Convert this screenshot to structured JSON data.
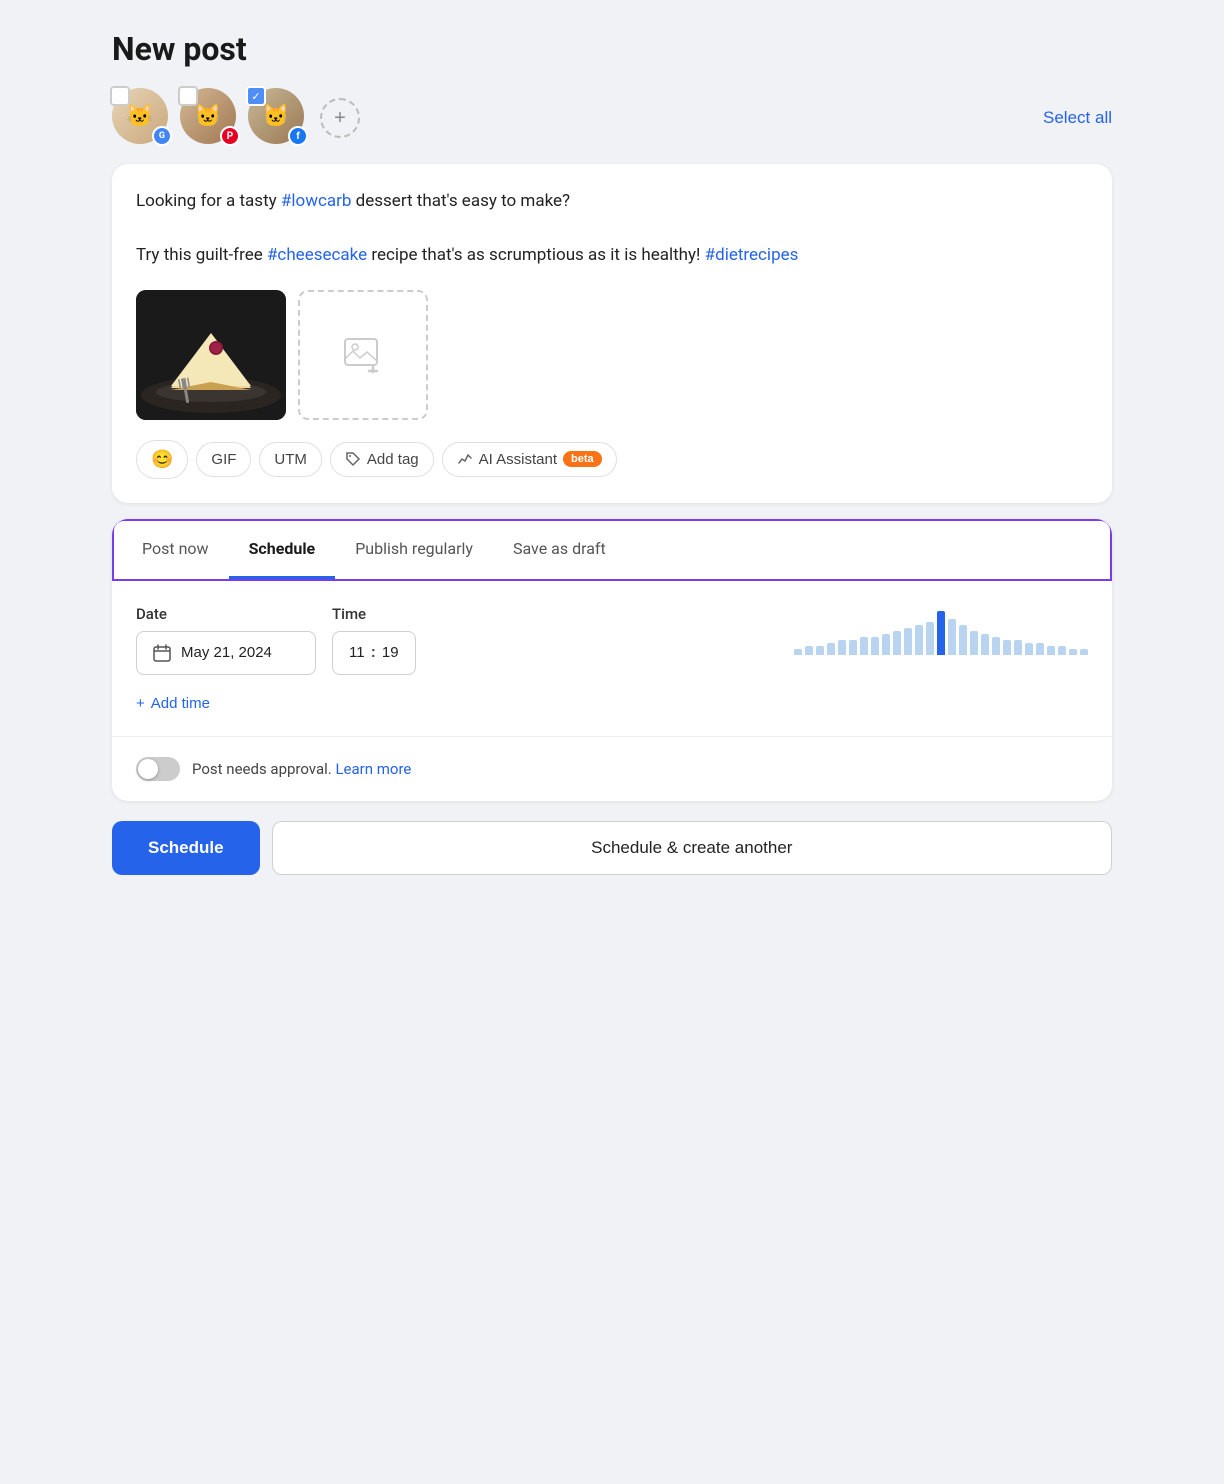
{
  "page": {
    "title": "New post"
  },
  "accounts": [
    {
      "id": "account-1",
      "name": "Cat with glasses Google",
      "checked": false,
      "platform": "google",
      "platform_label": "G"
    },
    {
      "id": "account-2",
      "name": "Cat with hat Pinterest",
      "checked": false,
      "platform": "pinterest",
      "platform_label": "P"
    },
    {
      "id": "account-3",
      "name": "Cat with sunglasses Facebook",
      "checked": true,
      "platform": "facebook",
      "platform_label": "f"
    }
  ],
  "add_account_label": "+",
  "select_all_label": "Select all",
  "post": {
    "text_line1": "Looking for a tasty ",
    "hashtag1": "#lowcarb",
    "text_line1b": " dessert that's easy to make?",
    "text_line2": "Try this guilt-free ",
    "hashtag2": "#cheesecake",
    "text_line2b": " recipe that's as scrumptious as it is healthy! ",
    "hashtag3": "#dietrecipes"
  },
  "toolbar": {
    "emoji_label": "",
    "gif_label": "GIF",
    "utm_label": "UTM",
    "tag_label": "Add tag",
    "ai_label": "AI Assistant",
    "ai_badge": "beta"
  },
  "schedule_section": {
    "tabs": [
      {
        "id": "post-now",
        "label": "Post now",
        "active": false
      },
      {
        "id": "schedule",
        "label": "Schedule",
        "active": true
      },
      {
        "id": "publish-regularly",
        "label": "Publish regularly",
        "active": false
      },
      {
        "id": "save-as-draft",
        "label": "Save as draft",
        "active": false
      }
    ],
    "date_label": "Date",
    "date_value": "May 21, 2024",
    "time_label": "Time",
    "time_hour": "11",
    "time_minute": "19",
    "add_time_label": "+ Add time",
    "bar_data": [
      2,
      3,
      3,
      4,
      5,
      5,
      6,
      6,
      7,
      8,
      9,
      10,
      11,
      15,
      12,
      10,
      8,
      7,
      6,
      5,
      5,
      4,
      4,
      3,
      3,
      2,
      2
    ],
    "active_bar_index": 13
  },
  "approval": {
    "text": "Post needs approval.",
    "learn_more": "Learn more",
    "toggle_state": false
  },
  "buttons": {
    "schedule_label": "Schedule",
    "schedule_another_label": "Schedule & create another"
  }
}
